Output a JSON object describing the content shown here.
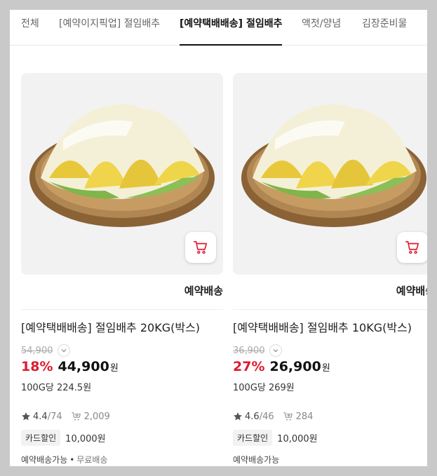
{
  "tabs": [
    {
      "label": "전체"
    },
    {
      "label": "[예약이지픽업] 절임배추"
    },
    {
      "label": "[예약택배배송] 절임배추"
    },
    {
      "label": "액젓/양념"
    },
    {
      "label": "김장준비물"
    }
  ],
  "active_tab": 2,
  "products": [
    {
      "delivery_tag": "예약배송",
      "title": "[예약택배배송] 절임배추 20KG(박스)",
      "original_price": "54,900",
      "discount_rate": "18%",
      "price": "44,900",
      "currency": "원",
      "unit_price": "100G당 224.5원",
      "rating": "4.4",
      "review_count": "/74",
      "wishlist_count": "2,009",
      "benefit_badge": "카드할인",
      "benefit_amount": "10,000원",
      "shipping": "예약배송가능",
      "shipping_extra": "무료배송"
    },
    {
      "delivery_tag": "예약배송",
      "title": "[예약택배배송] 절임배추 10KG(박스)",
      "original_price": "36,900",
      "discount_rate": "27%",
      "price": "26,900",
      "currency": "원",
      "unit_price": "100G당 269원",
      "rating": "4.6",
      "review_count": "/46",
      "wishlist_count": "284",
      "benefit_badge": "카드할인",
      "benefit_amount": "10,000원",
      "shipping": "예약배송가능"
    }
  ],
  "icons": {
    "cart": "cart-icon",
    "star": "star-icon",
    "wishlist": "cart-plus-icon",
    "toggle": "chevron-down-icon"
  },
  "colors": {
    "discount": "#e0192e",
    "cart_icon": "#e0192e",
    "background": "#c9c9c9"
  }
}
